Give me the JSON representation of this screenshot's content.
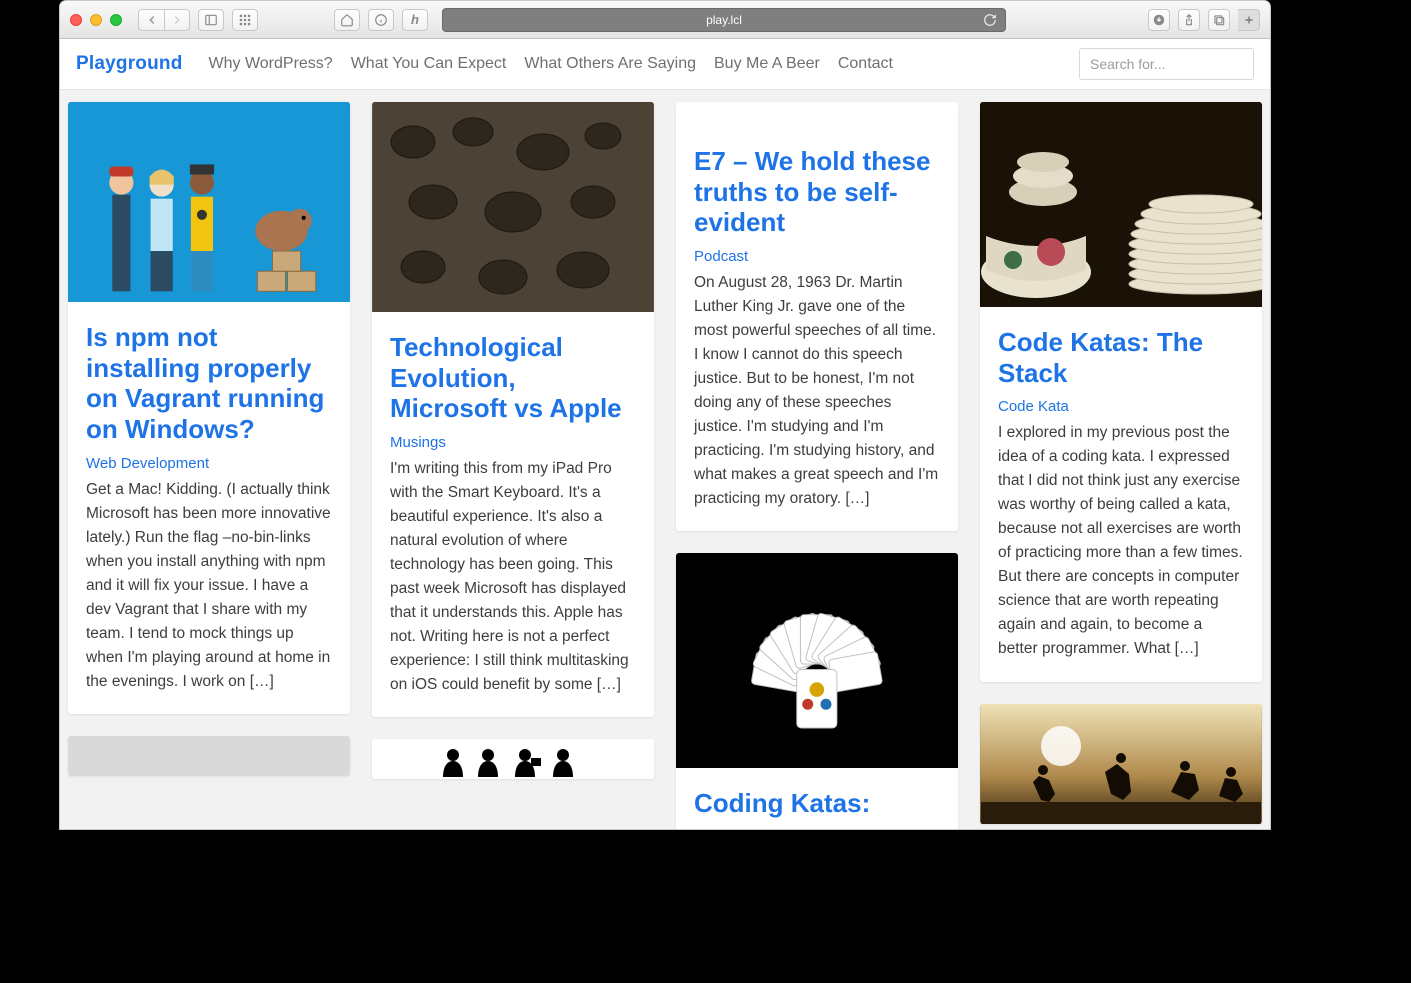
{
  "browser": {
    "url": "play.lcl"
  },
  "header": {
    "logo": "Playground",
    "nav": [
      "Why WordPress?",
      "What You Can Expect",
      "What Others Are Saying",
      "Buy Me A Beer",
      "Contact"
    ],
    "search_placeholder": "Search for..."
  },
  "cards": {
    "npm": {
      "title": "Is npm not installing properly on Vagrant running on Windows?",
      "category": "Web Development",
      "text": "Get a Mac! Kidding. (I actually think Microsoft has been more innovative lately.) Run the flag –no-bin-links when you install anything with npm and it will fix your issue. I have a dev Vagrant that I share with my team. I tend to mock things up when I'm playing around at home in the evenings. I work on […]"
    },
    "tech": {
      "title": "Technological Evolution, Microsoft vs Apple",
      "category": "Musings",
      "text": "I'm writing this from my iPad Pro with the Smart Keyboard. It's a beautiful experience. It's also a natural evolution of where technology has been going. This past week Microsoft has displayed that it understands this. Apple has not. Writing here is not a perfect experience: I still think multitasking on iOS could benefit by some […]"
    },
    "e7": {
      "title": "E7 – We hold these truths to be self-evident",
      "category": "Podcast",
      "text": "On August 28, 1963 Dr. Martin Luther King Jr. gave one of the most powerful speeches of all time. I know I cannot do this speech justice. But to be honest, I'm not doing any of these speeches justice. I'm studying and I'm practicing. I'm studying history, and what makes a great speech and I'm practicing my oratory. […]"
    },
    "insertion": {
      "title": "Coding Katas:"
    },
    "stack": {
      "title": "Code Katas: The Stack",
      "category": "Code Kata",
      "text": "I explored in my previous post the idea of a coding kata. I expressed that I did not think just any exercise was worthy of being called a kata, because not all exercises are worth of practicing more than a few times. But there are concepts in computer science that are worth repeating again and again, to become a better programmer. What […]"
    }
  }
}
